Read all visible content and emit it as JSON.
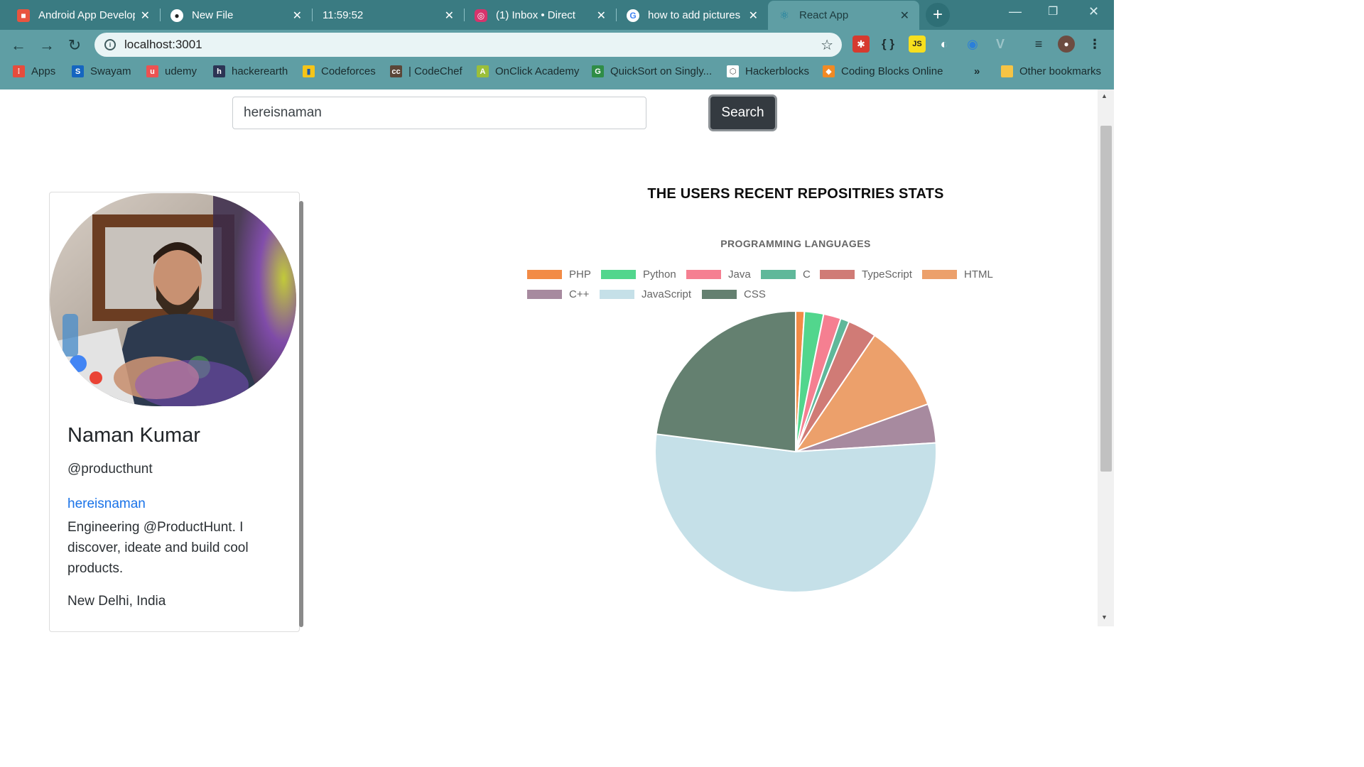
{
  "browser": {
    "tabs": [
      {
        "title": "Android App Develop",
        "icon": "cube-icon",
        "color": "#e8543f"
      },
      {
        "title": "New File",
        "icon": "github-icon",
        "color": "#ffffff"
      },
      {
        "title": "11:59:52",
        "icon": "",
        "color": ""
      },
      {
        "title": "(1) Inbox • Direct",
        "icon": "instagram-icon",
        "color": "#d6336c"
      },
      {
        "title": "how to add pictures",
        "icon": "google-icon",
        "color": "#ffffff"
      },
      {
        "title": "React App",
        "icon": "react-icon",
        "color": "#61dafb"
      }
    ],
    "url": "localhost:3001",
    "bookmarks": [
      {
        "label": "Apps",
        "color": "#e74c3c"
      },
      {
        "label": "Swayam",
        "color": "#1565c0"
      },
      {
        "label": "udemy",
        "color": "#ec5252"
      },
      {
        "label": "hackerearth",
        "color": "#2c3454"
      },
      {
        "label": "Codeforces",
        "color": "#f5c518"
      },
      {
        "label": "| CodeChef",
        "color": "#5b4638"
      },
      {
        "label": "OnClick Academy",
        "color": "#9bbf3a"
      },
      {
        "label": "QuickSort on Singly...",
        "color": "#2f8d46"
      },
      {
        "label": "Hackerblocks",
        "color": "#ffffff"
      },
      {
        "label": "Coding Blocks Online",
        "color": "#f08a24"
      }
    ],
    "overflow": "»",
    "other_bookmarks": "Other bookmarks"
  },
  "search": {
    "value": "hereisnaman",
    "button": "Search"
  },
  "profile": {
    "name": "Naman Kumar",
    "company": "@producthunt",
    "login": "hereisnaman",
    "bio": "Engineering @ProductHunt. I discover, ideate and build cool products.",
    "location": "New Delhi, India"
  },
  "stats": {
    "heading": "THE USERS RECENT REPOSITRIES STATS"
  },
  "chart_data": {
    "type": "pie",
    "title": "PROGRAMMING LANGUAGES",
    "legend_position": "top",
    "categories": [
      "PHP",
      "Python",
      "Java",
      "C",
      "TypeScript",
      "HTML",
      "C++",
      "JavaScript",
      "CSS"
    ],
    "values": [
      1,
      2.2,
      2,
      1,
      3.3,
      10,
      4.5,
      53,
      23
    ],
    "colors": [
      "#f28b46",
      "#52d68d",
      "#f57f91",
      "#5fb89a",
      "#d07b76",
      "#eca06b",
      "#a78a9f",
      "#c5e0e8",
      "#648070"
    ]
  }
}
